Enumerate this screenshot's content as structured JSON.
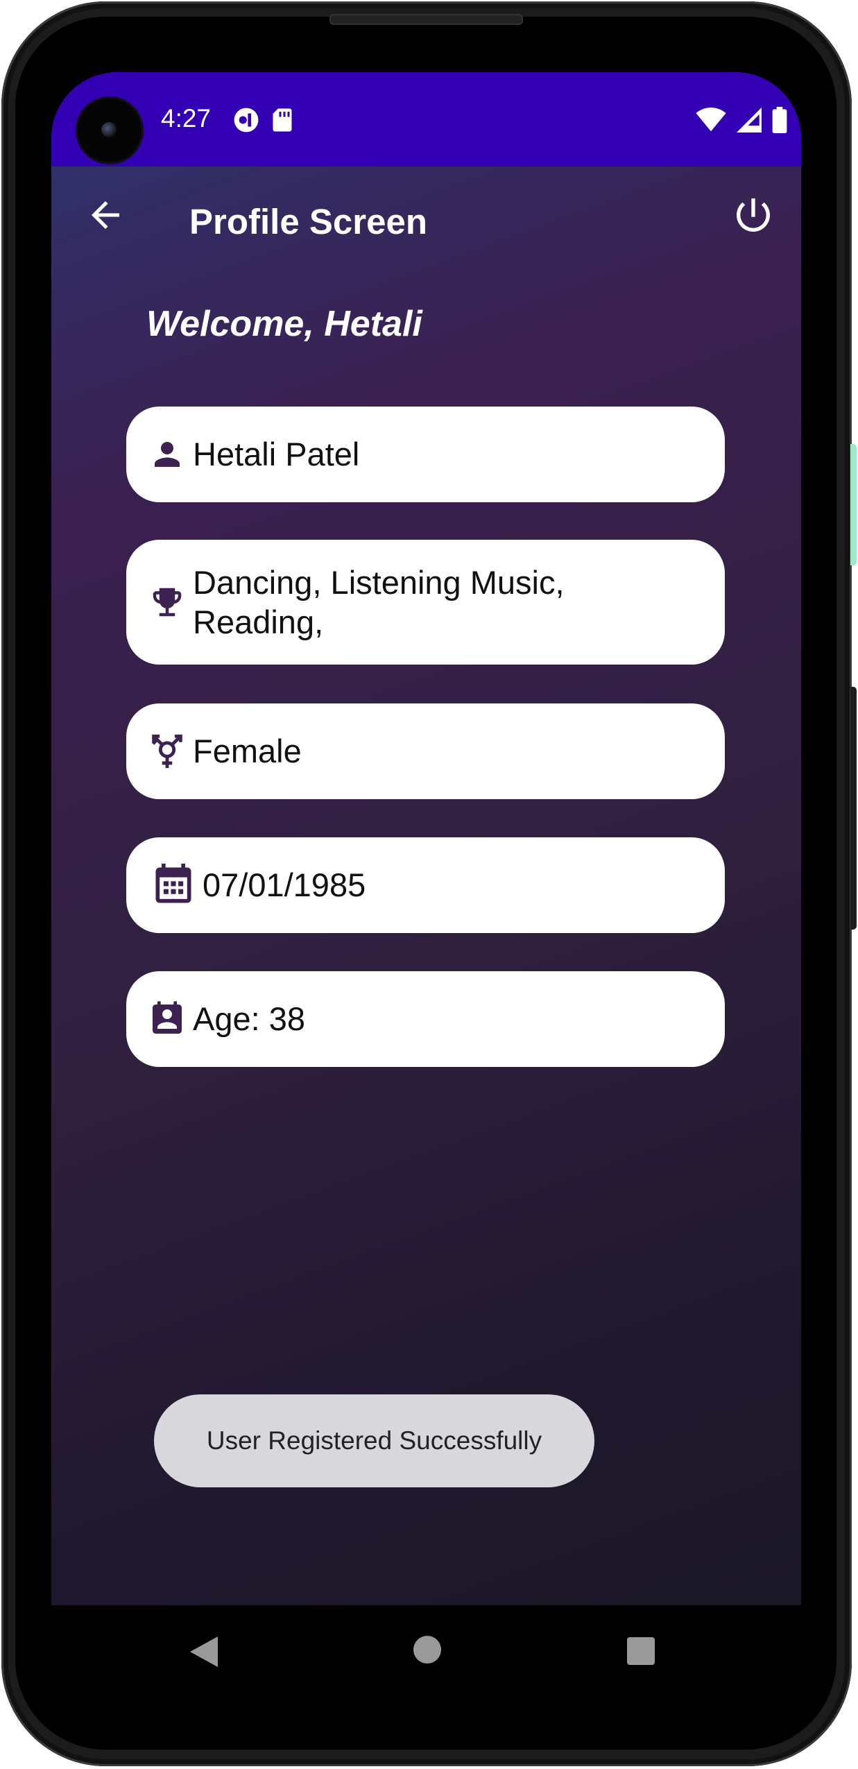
{
  "status_bar": {
    "time": "4:27",
    "background": "#3300b3"
  },
  "app_bar": {
    "title": "Profile Screen"
  },
  "welcome_text": "Welcome, Hetali",
  "profile": {
    "name": "Hetali Patel",
    "hobbies_line1": "Dancing, Listening Music,",
    "hobbies_line2": "Reading,",
    "gender": "Female",
    "dob": "07/01/1985",
    "age": "Age: 38"
  },
  "toast": {
    "message": "User Registered Successfully"
  },
  "icons": {
    "back": "arrow-left-icon",
    "power": "power-icon",
    "person": "person-icon",
    "hobbies": "trophy-icon",
    "gender": "gender-icon",
    "dob": "calendar-icon",
    "age": "contact-calendar-icon"
  },
  "colors": {
    "icon": "#3d2150",
    "card": "#ffffff",
    "toast": "#d8d8dc"
  }
}
